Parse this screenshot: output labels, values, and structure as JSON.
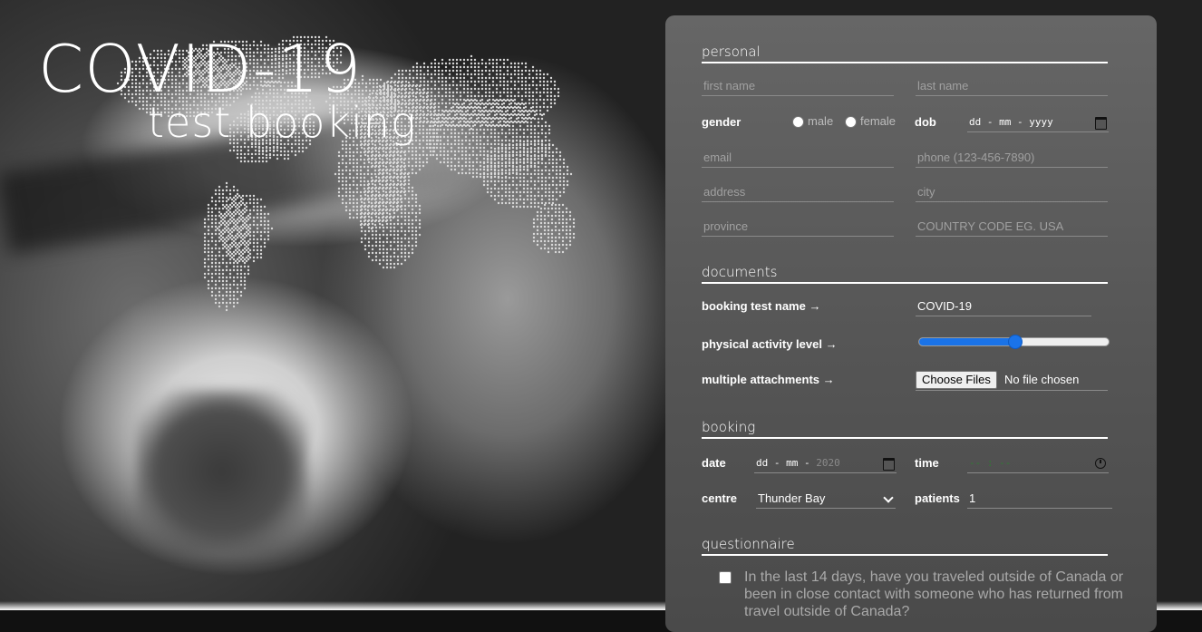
{
  "hero": {
    "title": "COVID-19",
    "subtitle": "test booking"
  },
  "sections": {
    "personal": "personal",
    "documents": "documents",
    "booking": "booking",
    "questionnaire": "questionnaire"
  },
  "personal": {
    "first_name_placeholder": "first name",
    "last_name_placeholder": "last name",
    "gender_label": "gender",
    "gender_options": [
      "male",
      "female"
    ],
    "dob_label": "dob",
    "dob_value": "dd - mm - yyyy",
    "email_placeholder": "email",
    "phone_placeholder": "phone (123-456-7890)",
    "address_placeholder": "address",
    "city_placeholder": "city",
    "province_placeholder": "province",
    "country_placeholder": "COUNTRY CODE EG. USA"
  },
  "documents": {
    "test_name_label": "booking test name →",
    "test_name_value": "COVID-19",
    "activity_label": "physical activity level →",
    "activity_level": 0.5,
    "attachments_label": "multiple attachments →",
    "choose_files": "Choose Files",
    "no_file": "No file chosen"
  },
  "booking": {
    "date_label": "date",
    "date_value_prefix": "dd - mm - ",
    "date_value_year": "2020",
    "time_label": "time",
    "time_value": "-- : --",
    "centre_label": "centre",
    "centre_value": "Thunder Bay",
    "patients_label": "patients",
    "patients_value": "1"
  },
  "questionnaire": {
    "q1": "In the last 14 days, have you traveled outside of Canada or been in close contact with someone who has returned from travel outside of Canada?"
  },
  "colors": {
    "accent": "#1a73e8",
    "time_placeholder": "#2e7d32"
  }
}
